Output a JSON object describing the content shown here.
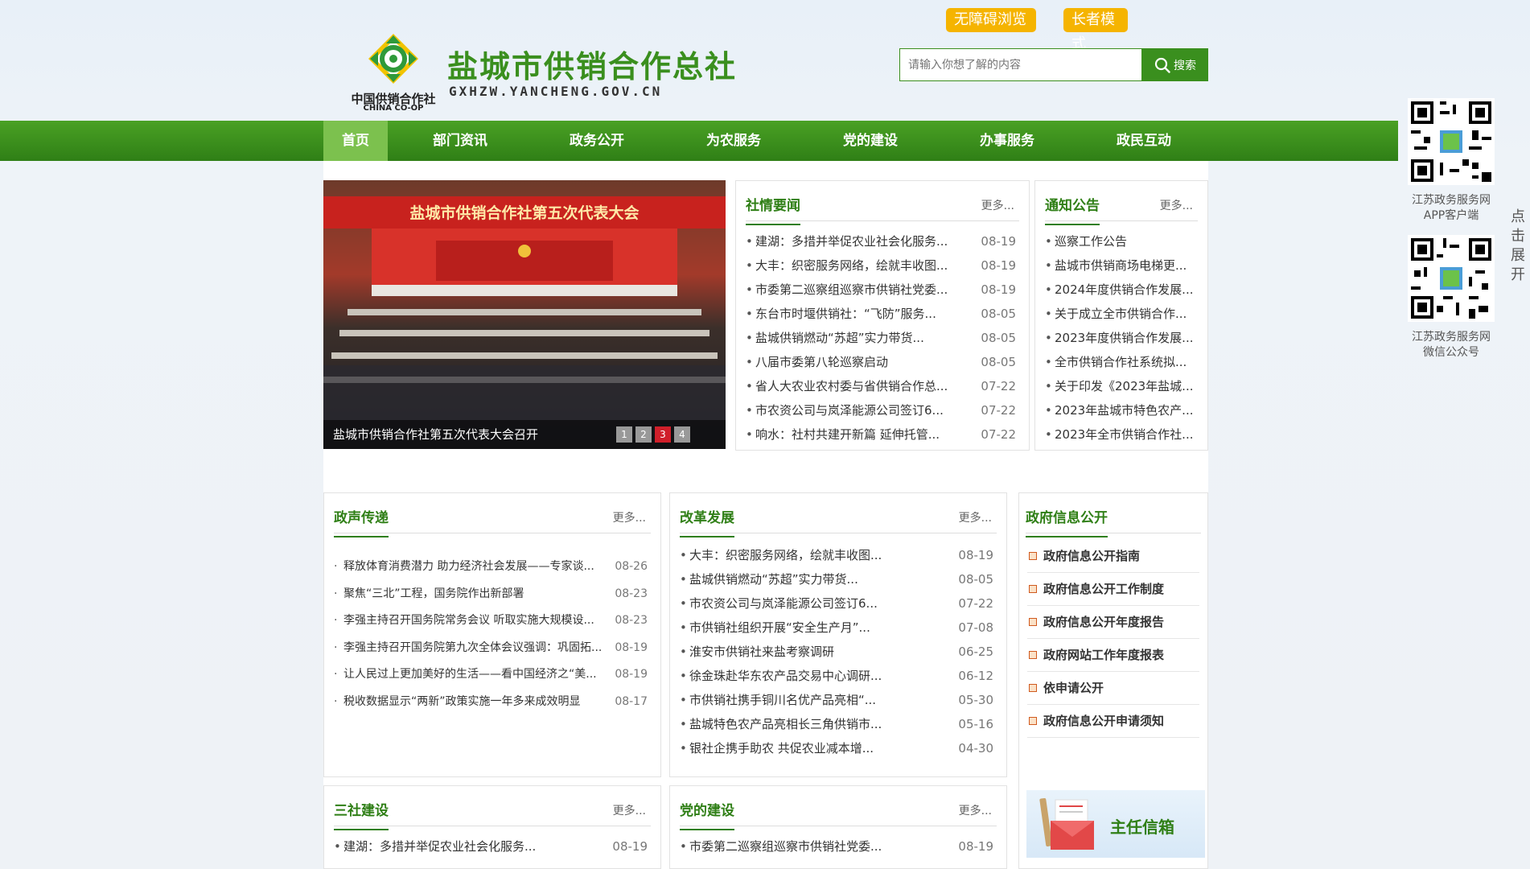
{
  "header": {
    "emblem_cn": "中国供销合作社",
    "emblem_en": "CHINA CO-OP",
    "site_title": "盐城市供销合作总社",
    "site_domain": "GXHZW.YANCHENG.GOV.CN",
    "accessible_label": "无障碍浏览",
    "elder_label": "长者模式",
    "search_placeholder": "请输入你想了解的内容",
    "search_label": "搜索"
  },
  "nav": {
    "items": [
      "首页",
      "部门资讯",
      "政务公开",
      "为农服务",
      "党的建设",
      "办事服务",
      "政民互动"
    ],
    "active": "首页"
  },
  "carousel": {
    "banner_text": "盐城市供销合作社第五次代表大会",
    "caption": "盐城市供销合作社第五次代表大会召开",
    "dots": [
      "1",
      "2",
      "3",
      "4"
    ],
    "active_dot": "3"
  },
  "she_qing": {
    "title": "社情要闻",
    "more": "更多...",
    "items": [
      {
        "title": "建湖：多措并举促农业社会化服务...",
        "date": "08-19"
      },
      {
        "title": "大丰：织密服务网络，绘就丰收图...",
        "date": "08-19"
      },
      {
        "title": "市委第二巡察组巡察市供销社党委...",
        "date": "08-19"
      },
      {
        "title": "东台市时堰供销社：“飞防”服务...",
        "date": "08-05"
      },
      {
        "title": "盐城供销燃动“苏超”实力带货...",
        "date": "08-05"
      },
      {
        "title": "八届市委第八轮巡察启动",
        "date": "08-05"
      },
      {
        "title": "省人大农业农村委与省供销合作总...",
        "date": "07-22"
      },
      {
        "title": "市农资公司与岚泽能源公司签订6...",
        "date": "07-22"
      },
      {
        "title": "响水：社村共建开新篇 延伸托管...",
        "date": "07-22"
      }
    ]
  },
  "notice": {
    "title": "通知公告",
    "more": "更多...",
    "items": [
      "巡察工作公告",
      "盐城市供销商场电梯更...",
      "2024年度供销合作发展...",
      "关于成立全市供销合作...",
      "2023年度供销合作发展...",
      "全市供销合作社系统拟...",
      "关于印发《2023年盐城...",
      "2023年盐城市特色农产...",
      "2023年全市供销合作社..."
    ]
  },
  "zheng_sheng": {
    "title": "政声传递",
    "more": "更多...",
    "items": [
      {
        "title": "释放体育消费潜力 助力经济社会发展——专家谈...",
        "date": "08-26"
      },
      {
        "title": "聚焦“三北”工程，国务院作出新部署",
        "date": "08-23"
      },
      {
        "title": "李强主持召开国务院常务会议 听取实施大规模设...",
        "date": "08-23"
      },
      {
        "title": "李强主持召开国务院第九次全体会议强调：巩固拓...",
        "date": "08-19"
      },
      {
        "title": "让人民过上更加美好的生活——看中国经济之“美...",
        "date": "08-19"
      },
      {
        "title": "税收数据显示“两新”政策实施一年多来成效明显",
        "date": "08-17"
      }
    ]
  },
  "gai_ge": {
    "title": "改革发展",
    "more": "更多...",
    "items": [
      {
        "title": "大丰：织密服务网络，绘就丰收图...",
        "date": "08-19"
      },
      {
        "title": "盐城供销燃动“苏超”实力带货...",
        "date": "08-05"
      },
      {
        "title": "市农资公司与岚泽能源公司签订6...",
        "date": "07-22"
      },
      {
        "title": "市供销社组织开展“安全生产月”...",
        "date": "07-08"
      },
      {
        "title": "淮安市供销社来盐考察调研",
        "date": "06-25"
      },
      {
        "title": "徐金珠赴华东农产品交易中心调研...",
        "date": "06-12"
      },
      {
        "title": "市供销社携手铜川名优产品亮相“...",
        "date": "05-30"
      },
      {
        "title": "盐城特色农产品亮相长三角供销市...",
        "date": "05-16"
      },
      {
        "title": "银社企携手助农 共促农业减本增...",
        "date": "04-30"
      }
    ]
  },
  "gov_info": {
    "title": "政府信息公开",
    "items": [
      "政府信息公开指南",
      "政府信息公开工作制度",
      "政府信息公开年度报告",
      "政府网站工作年度报表",
      "依申请公开",
      "政府信息公开申请须知"
    ]
  },
  "san_she": {
    "title": "三社建设",
    "more": "更多...",
    "items": [
      {
        "title": "建湖：多措并举促农业社会化服务...",
        "date": "08-19"
      }
    ]
  },
  "dang_jian": {
    "title": "党的建设",
    "more": "更多...",
    "items": [
      {
        "title": "市委第二巡察组巡察市供销社党委...",
        "date": "08-19"
      }
    ]
  },
  "mailbox": {
    "label": "主任信箱"
  },
  "sidebar": {
    "qr1_caption_1": "江苏政务服务网",
    "qr1_caption_2": "APP客户端",
    "qr2_caption_1": "江苏政务服务网",
    "qr2_caption_2": "微信公众号",
    "expand_label": "点击展开"
  },
  "colors": {
    "brand_green": "#2f7f16",
    "title_green": "#3a8f1e",
    "nav_active": "#7cc14e",
    "accent_yellow": "#f5b400",
    "dot_active": "#d01f2a"
  }
}
